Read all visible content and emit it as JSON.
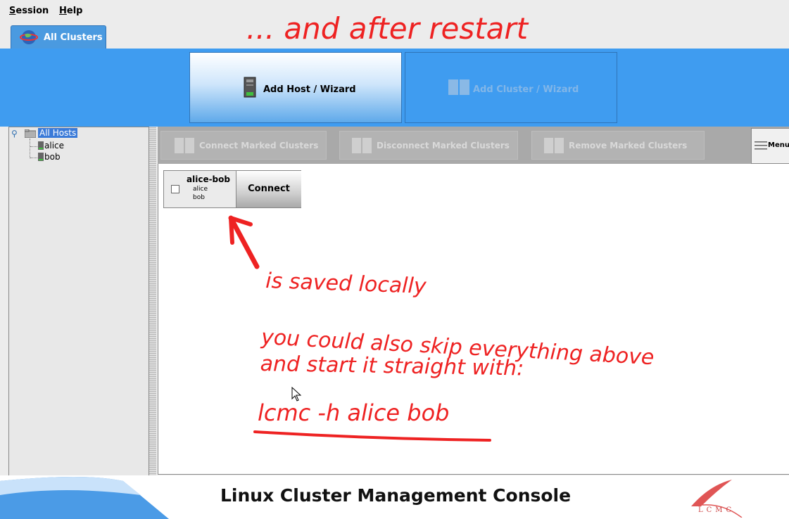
{
  "menubar": {
    "session": {
      "first": "S",
      "rest": "ession"
    },
    "help": {
      "first": "H",
      "rest": "elp"
    }
  },
  "tab": {
    "label": "All Clusters",
    "icon": "globe-icon"
  },
  "toolbar_top": {
    "add_host": "Add Host / Wizard",
    "add_cluster": "Add Cluster / Wizard"
  },
  "tree": {
    "root": "All Hosts",
    "hosts": [
      "alice",
      "bob"
    ]
  },
  "actions": {
    "connect_marked": "Connect Marked Clusters",
    "disconnect_marked": "Disconnect Marked Clusters",
    "remove_marked": "Remove Marked Clusters",
    "menu": "Menu"
  },
  "cluster": {
    "name": "alice-bob",
    "hosts": [
      "alice",
      "bob"
    ],
    "connect_label": "Connect"
  },
  "annotations": {
    "title": "... and after restart",
    "saved": "is saved locally",
    "line1": "you could also skip everything above",
    "line2": "and start it straight with:",
    "command": "lcmc -h alice bob"
  },
  "footer": {
    "title": "Linux Cluster Management Console",
    "logo_text": "LCMC"
  },
  "colors": {
    "accent": "#3f9cf0",
    "annotation": "#ee2222"
  }
}
